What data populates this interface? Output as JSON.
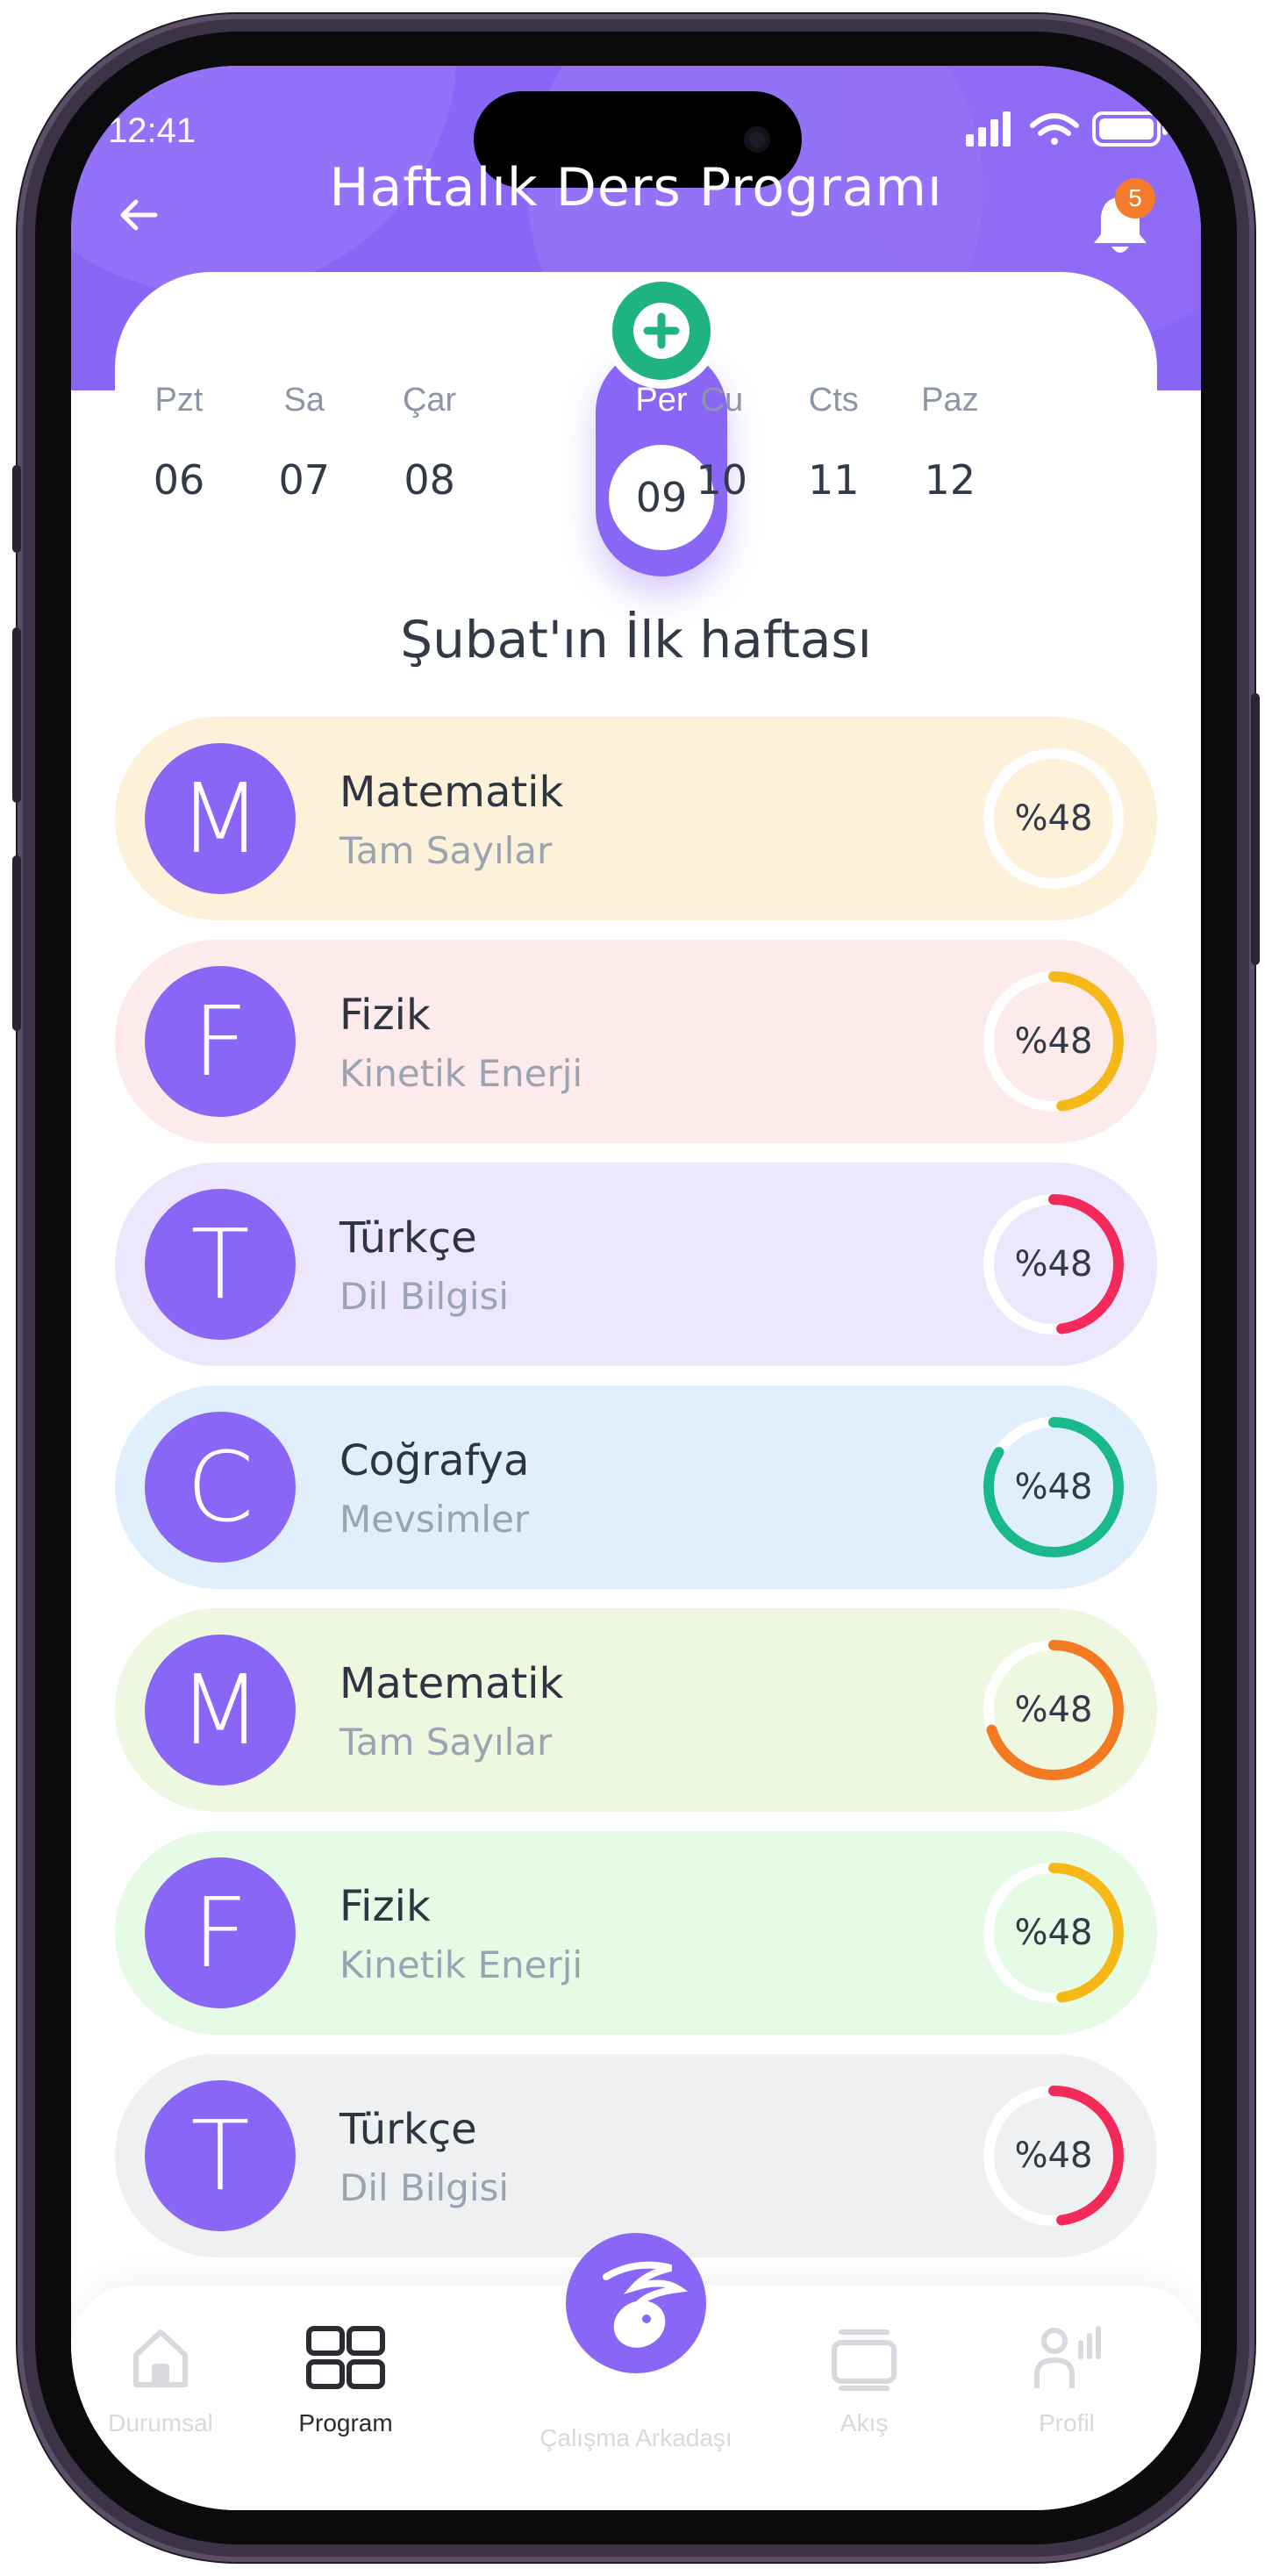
{
  "status": {
    "time": "12:41"
  },
  "header": {
    "title": "Haftalık Ders Programı",
    "notifications": "5"
  },
  "days": [
    {
      "name": "Pzt",
      "num": "06"
    },
    {
      "name": "Sa",
      "num": "07"
    },
    {
      "name": "Çar",
      "num": "08"
    },
    {
      "name": "Per",
      "num": "09"
    },
    {
      "name": "Cu",
      "num": "10"
    },
    {
      "name": "Cts",
      "num": "11"
    },
    {
      "name": "Paz",
      "num": "12"
    }
  ],
  "selected_day": "Per",
  "week_title": "Şubat'ın İlk haftası",
  "lessons": [
    {
      "letter": "M",
      "title": "Matematik",
      "sub": "Tam Sayılar",
      "progress": "%48",
      "bg": "#fdf2d9",
      "ring": "#ffffff",
      "fill": 0
    },
    {
      "letter": "F",
      "title": "Fizik",
      "sub": "Kinetik Enerji",
      "progress": "%48",
      "bg": "#fdeaea",
      "ring": "#f5b817",
      "fill": 0.48
    },
    {
      "letter": "T",
      "title": "Türkçe",
      "sub": "Dil Bilgisi",
      "progress": "%48",
      "bg": "#ece7fd",
      "ring": "#f22a5a",
      "fill": 0.48
    },
    {
      "letter": "C",
      "title": "Coğrafya",
      "sub": "Mevsimler",
      "progress": "%48",
      "bg": "#e1eefb",
      "ring": "#19b98a",
      "fill": 0.84
    },
    {
      "letter": "M",
      "title": "Matematik",
      "sub": "Tam Sayılar",
      "progress": "%48",
      "bg": "#eef8e1",
      "ring": "#f47a21",
      "fill": 0.7
    },
    {
      "letter": "F",
      "title": "Fizik",
      "sub": "Kinetik Enerji",
      "progress": "%48",
      "bg": "#e6fbe5",
      "ring": "#f5b817",
      "fill": 0.48
    },
    {
      "letter": "T",
      "title": "Türkçe",
      "sub": "Dil Bilgisi",
      "progress": "%48",
      "bg": "#eff0f2",
      "ring": "#f22a5a",
      "fill": 0.48
    }
  ],
  "tabs": {
    "home": "Durumsal",
    "program": "Program",
    "center": "Çalışma Arkadaşı",
    "feed": "Akış",
    "profile": "Profil"
  },
  "colors": {
    "accent": "#8a66f6",
    "add": "#1fb37f",
    "badge": "#f47a2c",
    "track": "#ffffff"
  },
  "icons": [
    "back-arrow-icon",
    "bell-icon",
    "plus-icon",
    "home-icon",
    "grid-icon",
    "rabbit-icon",
    "cards-icon",
    "profile-icon"
  ]
}
